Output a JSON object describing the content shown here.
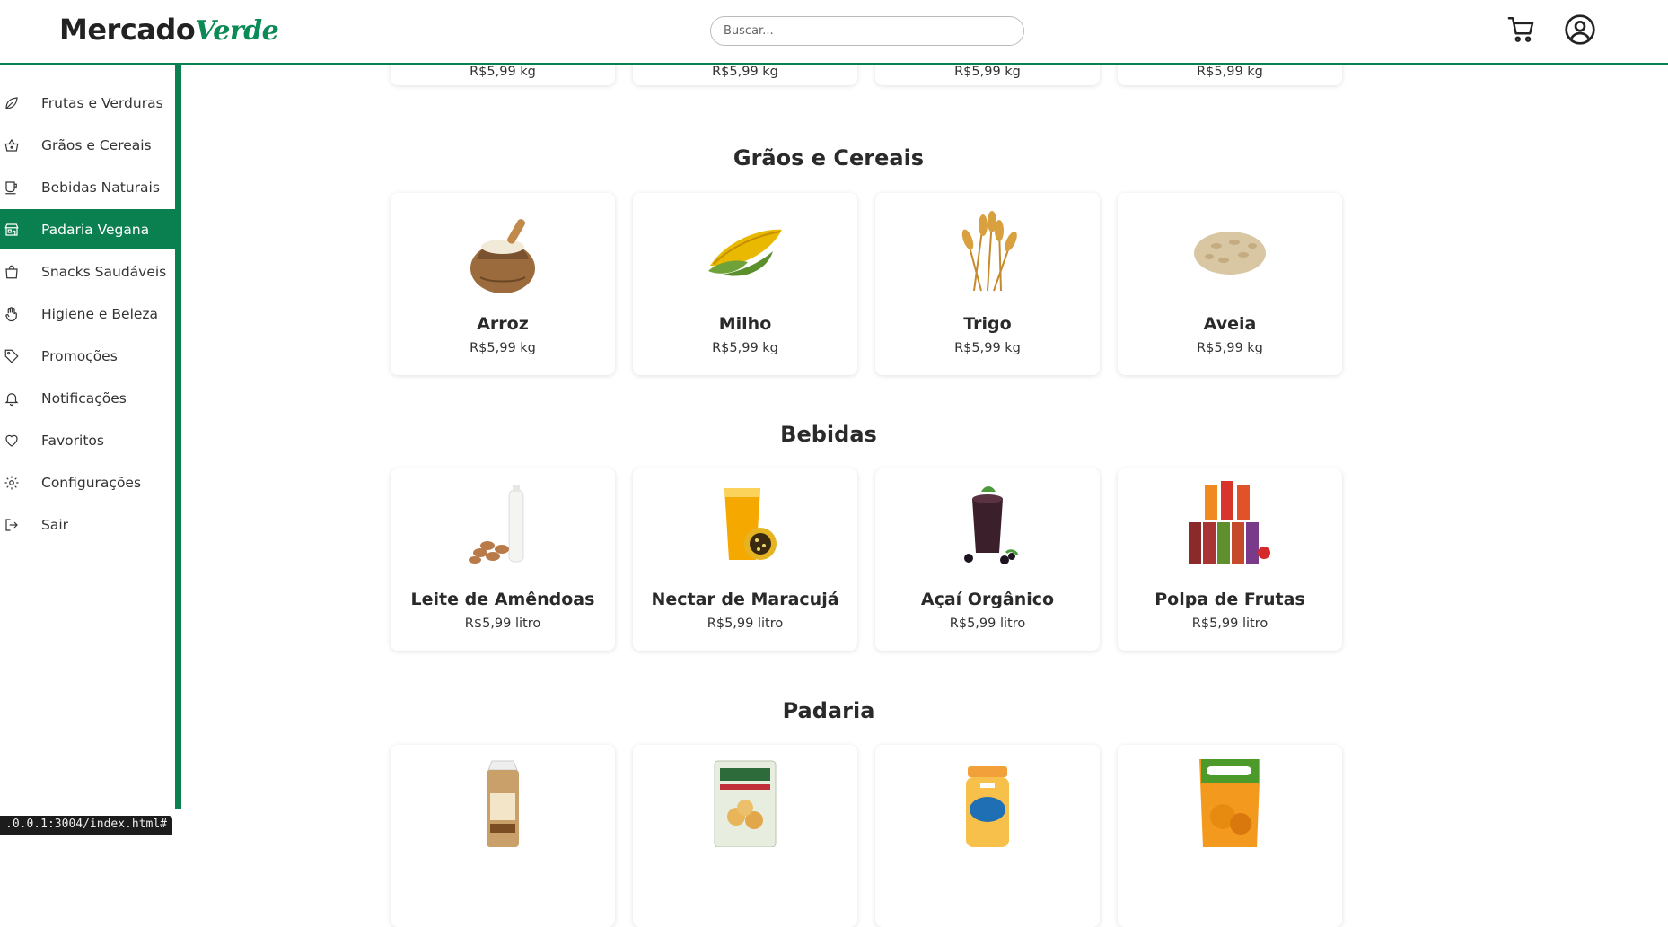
{
  "brand": {
    "part1": "Mercado",
    "part2": "Verde"
  },
  "search": {
    "placeholder": "Buscar..."
  },
  "icons": {
    "cart": "cart-icon",
    "account": "user-circle-icon"
  },
  "accent_color": "#0a7f4f",
  "sidebar": {
    "items": [
      {
        "label": "Frutas e Verduras",
        "icon": "leaf-icon"
      },
      {
        "label": "Grãos e Cereais",
        "icon": "basket-icon"
      },
      {
        "label": "Bebidas Naturais",
        "icon": "cup-icon"
      },
      {
        "label": "Padaria Vegana",
        "icon": "store-icon",
        "active": true
      },
      {
        "label": "Snacks Saudáveis",
        "icon": "bag-icon"
      },
      {
        "label": "Higiene e Beleza",
        "icon": "hand-icon"
      },
      {
        "label": "Promoções",
        "icon": "tag-icon"
      },
      {
        "label": "Notificações",
        "icon": "bell-icon"
      },
      {
        "label": "Favoritos",
        "icon": "heart-icon"
      },
      {
        "label": "Configurações",
        "icon": "gear-icon"
      },
      {
        "label": "Sair",
        "icon": "logout-icon"
      }
    ]
  },
  "top_row": {
    "prices": [
      "R$5,99 kg",
      "R$5,99 kg",
      "R$5,99 kg",
      "R$5,99 kg"
    ]
  },
  "sections": [
    {
      "title": "Grãos e Cereais",
      "products": [
        {
          "name": "Arroz",
          "price": "R$5,99 kg",
          "image": "rice-sack-image"
        },
        {
          "name": "Milho",
          "price": "R$5,99 kg",
          "image": "corn-image"
        },
        {
          "name": "Trigo",
          "price": "R$5,99 kg",
          "image": "wheat-image"
        },
        {
          "name": "Aveia",
          "price": "R$5,99 kg",
          "image": "oats-image"
        }
      ]
    },
    {
      "title": "Bebidas",
      "products": [
        {
          "name": "Leite de Amêndoas",
          "price": "R$5,99 litro",
          "image": "almond-milk-image"
        },
        {
          "name": "Nectar de Maracujá",
          "price": "R$5,99 litro",
          "image": "passionfruit-juice-image"
        },
        {
          "name": "Açaí Orgânico",
          "price": "R$5,99 litro",
          "image": "acai-image"
        },
        {
          "name": "Polpa de Frutas",
          "price": "R$5,99 litro",
          "image": "fruit-pulp-image"
        }
      ]
    },
    {
      "title": "Padaria",
      "products": [
        {
          "name": "",
          "price": "",
          "image": "bread-bag-image"
        },
        {
          "name": "",
          "price": "",
          "image": "cheese-bread-pack-image"
        },
        {
          "name": "",
          "price": "",
          "image": "jar-image"
        },
        {
          "name": "",
          "price": "",
          "image": "snack-pack-image"
        }
      ]
    }
  ],
  "status_bar": {
    "url": ".0.0.1:3004/index.html#"
  }
}
